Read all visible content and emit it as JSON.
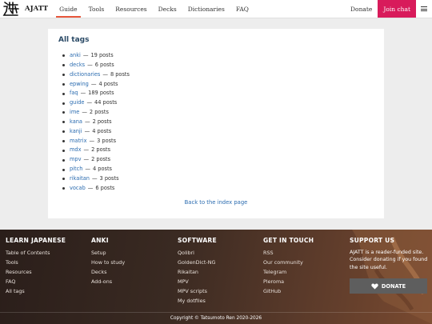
{
  "brand": {
    "name": "AJATT"
  },
  "nav": {
    "links": [
      "Guide",
      "Tools",
      "Resources",
      "Decks",
      "Dictionaries",
      "FAQ"
    ],
    "donate": "Donate",
    "join": "Join chat",
    "accent": "#d81b5b"
  },
  "page": {
    "title": "All tags",
    "tags": [
      {
        "name": "anki",
        "count": "19 posts"
      },
      {
        "name": "decks",
        "count": "6 posts"
      },
      {
        "name": "dictionaries",
        "count": "8 posts"
      },
      {
        "name": "epwing",
        "count": "4 posts"
      },
      {
        "name": "faq",
        "count": "189 posts"
      },
      {
        "name": "guide",
        "count": "44 posts"
      },
      {
        "name": "ime",
        "count": "2 posts"
      },
      {
        "name": "kana",
        "count": "2 posts"
      },
      {
        "name": "kanji",
        "count": "4 posts"
      },
      {
        "name": "matrix",
        "count": "3 posts"
      },
      {
        "name": "mdx",
        "count": "2 posts"
      },
      {
        "name": "mpv",
        "count": "2 posts"
      },
      {
        "name": "pitch",
        "count": "4 posts"
      },
      {
        "name": "rikaitan",
        "count": "3 posts"
      },
      {
        "name": "vocab",
        "count": "6 posts"
      }
    ],
    "separator": "—",
    "back_link": "Back to the index page"
  },
  "footer": {
    "learn": {
      "title": "LEARN JAPANESE",
      "items": [
        "Table of Contents",
        "Tools",
        "Resources",
        "FAQ",
        "All tags"
      ]
    },
    "anki": {
      "title": "ANKI",
      "items": [
        "Setup",
        "How to study",
        "Decks",
        "Add-ons"
      ]
    },
    "software": {
      "title": "SOFTWARE",
      "items": [
        "Qolibri",
        "GoldenDict-NG",
        "Rikaitan",
        "MPV",
        "MPV scripts",
        "My dotfiles"
      ]
    },
    "contact": {
      "title": "GET IN TOUCH",
      "items": [
        "RSS",
        "Our community",
        "Telegram",
        "Pleroma",
        "GitHub"
      ]
    },
    "support": {
      "title": "SUPPORT US",
      "text": "AJATT is a reader-funded site. Consider donating if you found the site useful.",
      "button": "DONATE"
    },
    "copyright": "Copyright © Tatsumoto Ren 2020-2026"
  }
}
